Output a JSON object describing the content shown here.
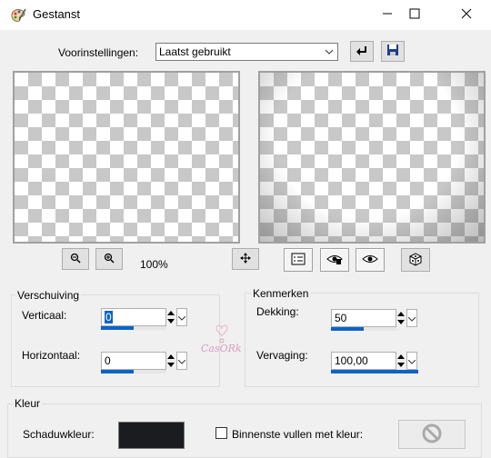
{
  "window": {
    "title": "Gestanst",
    "minimize_icon": "minimize-icon",
    "maximize_icon": "maximize-icon",
    "close_icon": "close-icon"
  },
  "presets": {
    "label": "Voorinstellingen:",
    "selected": "Laatst gebruikt",
    "reset_icon": "reset-icon",
    "save_icon": "save-icon"
  },
  "preview": {
    "zoom_label": "100%",
    "zoom_out_icon": "zoom-out-icon",
    "zoom_in_icon": "zoom-in-icon",
    "pan_icon": "pan-icon"
  },
  "toolbar": {
    "properties_icon": "properties-icon",
    "proof_icon": "proof-icon",
    "auto_proof_icon": "auto-proof-icon",
    "randomize_icon": "dice-icon"
  },
  "offset": {
    "title": "Verschuiving",
    "vertical_label": "Verticaal:",
    "vertical_value": "0",
    "vertical_fill": 0.5,
    "horizontal_label": "Horizontaal:",
    "horizontal_value": "0",
    "horizontal_fill": 0.5
  },
  "attributes": {
    "title": "Kenmerken",
    "opacity_label": "Dekking:",
    "opacity_value": "50",
    "opacity_fill": 0.5,
    "blur_label": "Vervaging:",
    "blur_value": "100,00",
    "blur_fill": 1.0
  },
  "color": {
    "title": "Kleur",
    "shadow_color_label": "Schaduwkleur:",
    "shadow_color": "#1b1c20",
    "fill_inside_label": "Binnenste vullen met kleur:",
    "fill_inside_checked": false,
    "no_color_icon": "no-color-icon"
  },
  "watermark": {
    "text": "CasORk"
  },
  "colors": {
    "accent": "#0a64c8",
    "checker": "#c8c8c8",
    "background": "#f0f0f0"
  }
}
